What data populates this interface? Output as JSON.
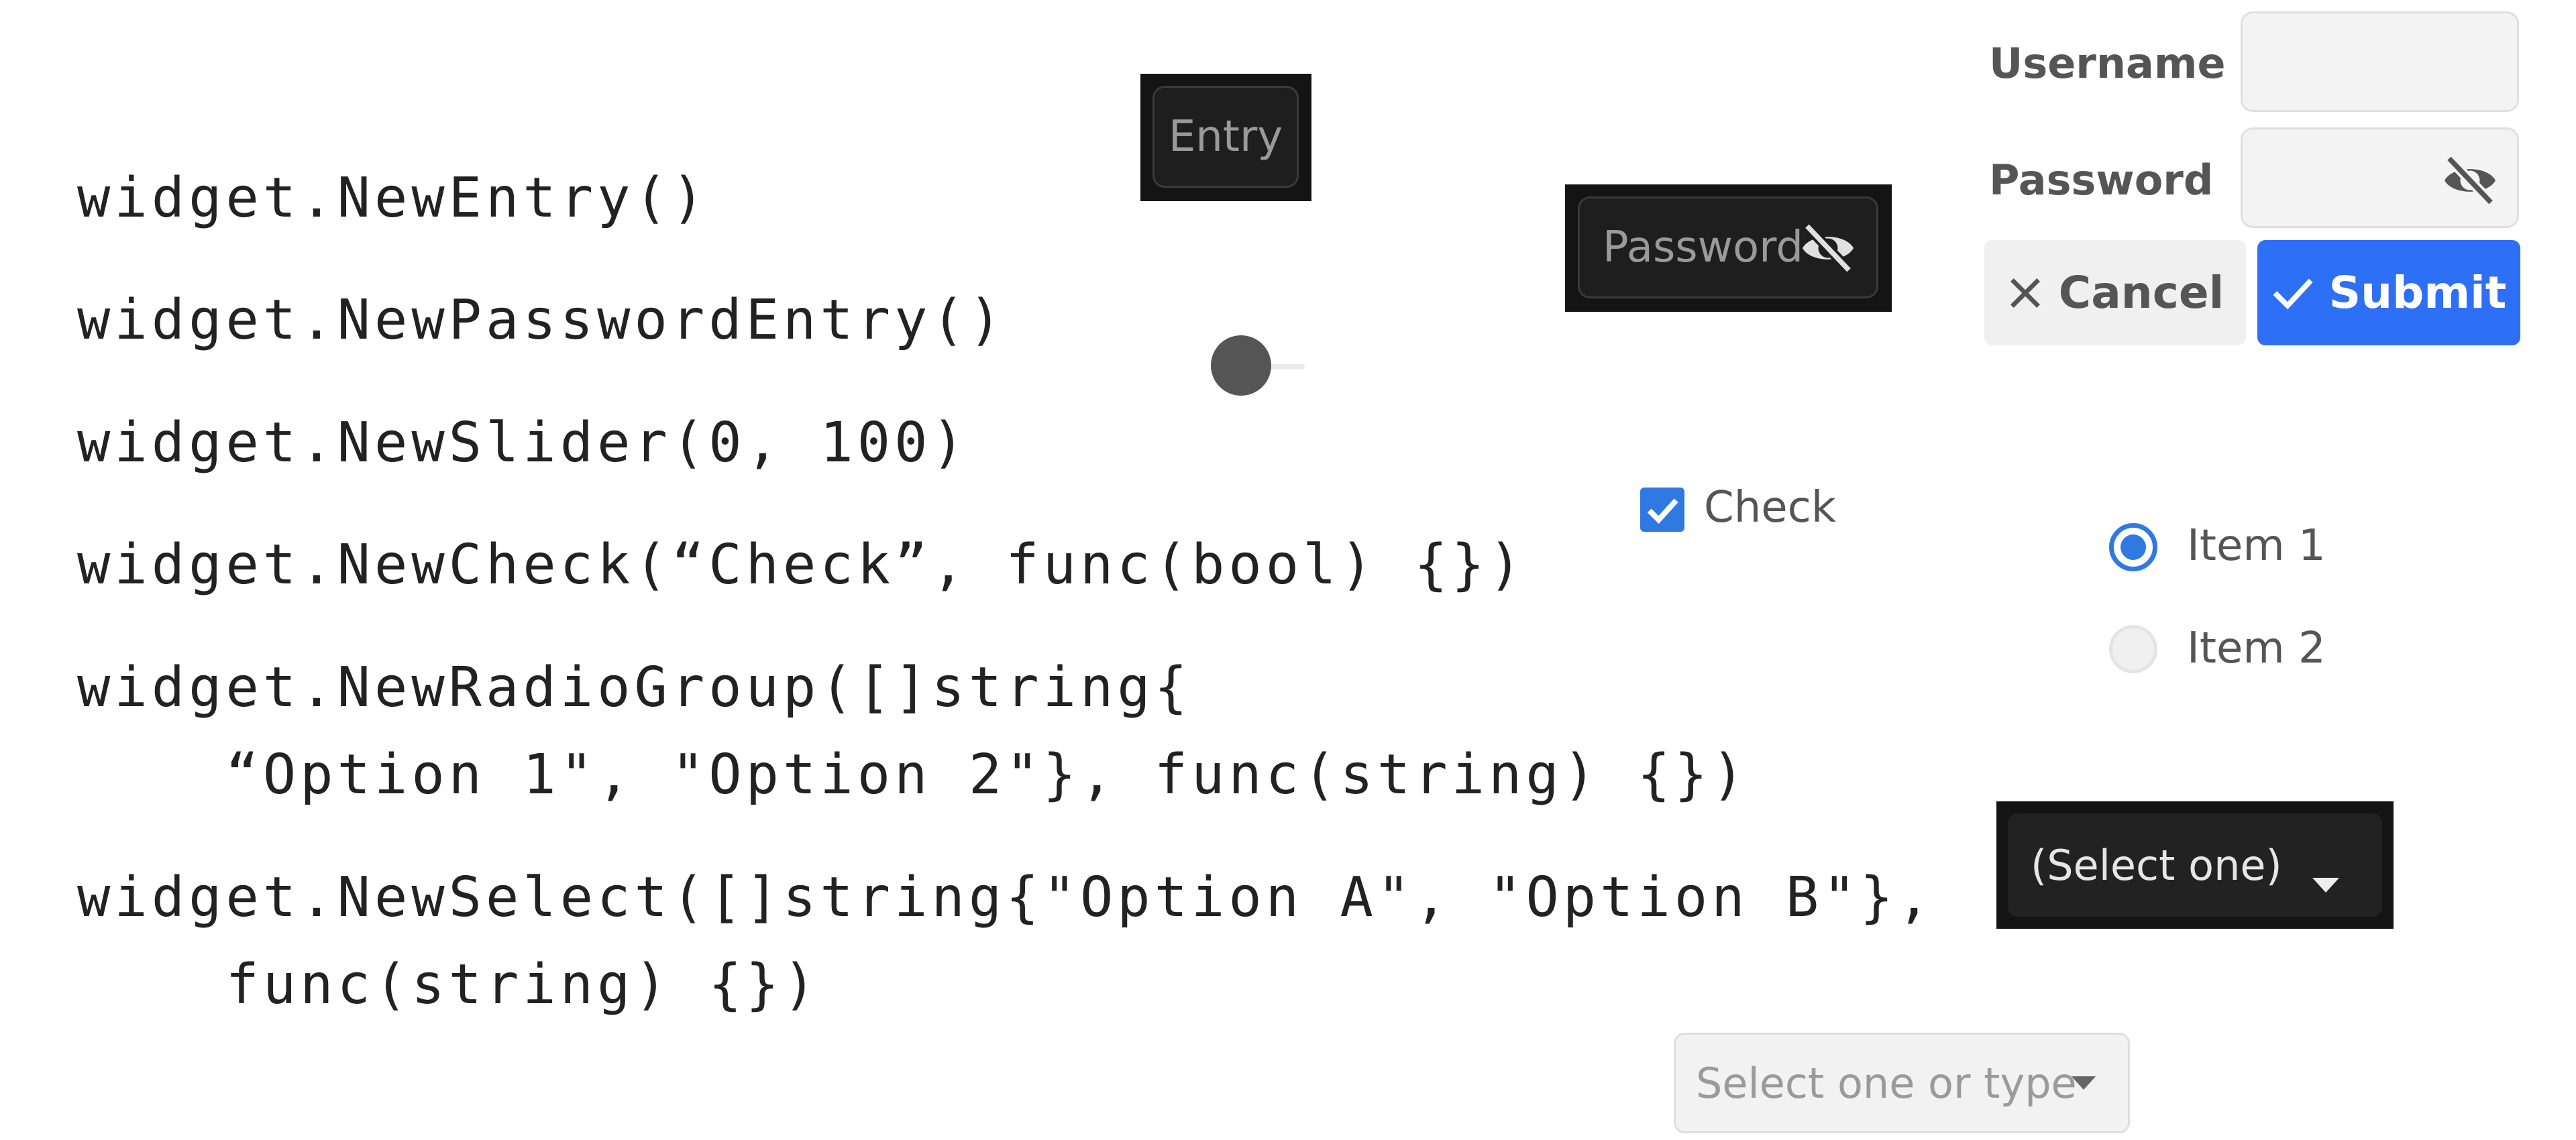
{
  "code": {
    "lines": [
      "widget.NewEntry()",
      "widget.NewPasswordEntry()",
      "widget.NewSlider(0, 100)",
      "widget.NewCheck(“Check”, func(bool) {})",
      "widget.NewRadioGroup([]string{",
      "    “Option 1\", \"Option 2\"}, func(string) {})",
      "widget.NewSelect([]string{\"Option A\", \"Option B\"},",
      "    func(string) {})"
    ]
  },
  "entry": {
    "placeholder": "Entry"
  },
  "password_entry": {
    "placeholder": "Password",
    "icon": "eye-slash-icon"
  },
  "slider": {
    "min": 0,
    "max": 100,
    "value": 0
  },
  "check": {
    "label": "Check",
    "checked": true
  },
  "radio": {
    "items": [
      {
        "label": "Item 1",
        "selected": true
      },
      {
        "label": "Item 2",
        "selected": false
      }
    ]
  },
  "select": {
    "placeholder": "(Select one)",
    "icon": "caret-down-icon"
  },
  "select_entry": {
    "placeholder": "Select one or type",
    "icon": "caret-down-icon"
  },
  "form": {
    "username_label": "Username",
    "password_label": "Password",
    "cancel_label": "Cancel",
    "submit_label": "Submit"
  },
  "colors": {
    "accent": "#2d6ff5",
    "check_blue": "#2f79e0",
    "dark_bg": "#141414"
  }
}
